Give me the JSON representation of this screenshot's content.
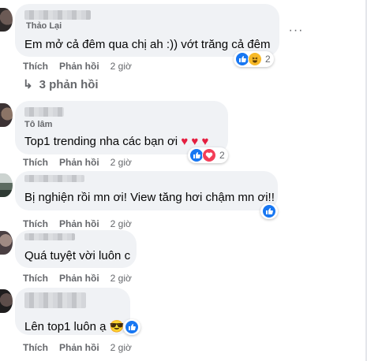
{
  "comments": [
    {
      "name_fragment": "Thảo Lại",
      "text": "Em mở cả đêm qua chị ah :)) vớt trăng cả đêm",
      "like_label": "Thích",
      "reply_label": "Phản hồi",
      "time": "2 giờ",
      "reaction_count": "2",
      "reactions": [
        "like-icon",
        "haha-icon"
      ]
    },
    {
      "name_fragment": "Tô lâm",
      "text": "Top1 trending nha các bạn ơi",
      "emoji": "♥ ♥ ♥",
      "like_label": "Thích",
      "reply_label": "Phản hồi",
      "time": "2 giờ",
      "reaction_count": "2",
      "reactions": [
        "like-icon",
        "love-icon"
      ]
    },
    {
      "name_fragment": "Trang Phạm",
      "text": "Bị nghiện rồi mn ơi! View tăng hơi chậm mn ơi!!",
      "like_label": "Thích",
      "reply_label": "Phản hồi",
      "time": "2 giờ",
      "reactions": [
        "like-icon"
      ]
    },
    {
      "name_fragment": "Kim Ngọc",
      "text": "Quá tuyệt vời luôn c",
      "like_label": "Thích",
      "reply_label": "Phản hồi",
      "time": "2 giờ"
    },
    {
      "name_fragment": "",
      "text": "Lên top1 luôn ạ",
      "emoji": "😎",
      "like_label": "Thích",
      "reply_label": "Phản hồi",
      "time": "2 giờ",
      "reactions": [
        "like-icon"
      ]
    }
  ],
  "view_replies": "3 phản hồi",
  "more_label": "···",
  "colors": {
    "bubble": "#f0f2f5",
    "meta": "#65676b",
    "like_blue": "#1877f2",
    "love_red": "#f33e58",
    "haha_yellow": "#f7b928"
  }
}
